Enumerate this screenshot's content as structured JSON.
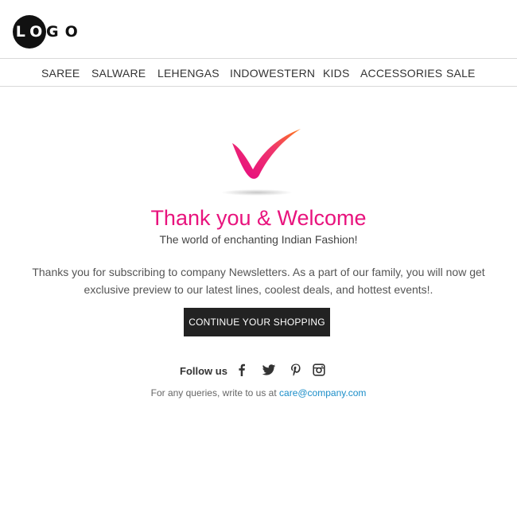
{
  "header": {
    "logo_text_inverse": "LO",
    "logo_text": "GO"
  },
  "nav": {
    "items": [
      {
        "label": "SAREE"
      },
      {
        "label": "SALWARE"
      },
      {
        "label": "LEHENGAS"
      },
      {
        "label": "INDOWESTERN"
      },
      {
        "label": "KIDS"
      },
      {
        "label": "ACCESSORIES"
      },
      {
        "label": "SALE"
      }
    ]
  },
  "hero": {
    "icon": "checkmark-icon",
    "title": "Thank you & Welcome",
    "subtitle": "The world of enchanting Indian Fashion!",
    "message": "Thanks you for subscribing to company Newsletters. As a part of our family, you will now get exclusive preview to our latest lines, coolest deals, and hottest events!.",
    "cta_label": "CONTINUE YOUR SHOPPING"
  },
  "social": {
    "label": "Follow us",
    "icons": [
      "facebook-icon",
      "twitter-icon",
      "pinterest-icon",
      "instagram-icon"
    ]
  },
  "footer": {
    "queries_text": "For any queries, write to us at",
    "email": "care@company.com"
  },
  "colors": {
    "accent": "#e8137d",
    "link": "#1a8dc8",
    "button_bg": "#222222",
    "check_gradient_start": "#ff7a1a",
    "check_gradient_end": "#e8137d"
  }
}
